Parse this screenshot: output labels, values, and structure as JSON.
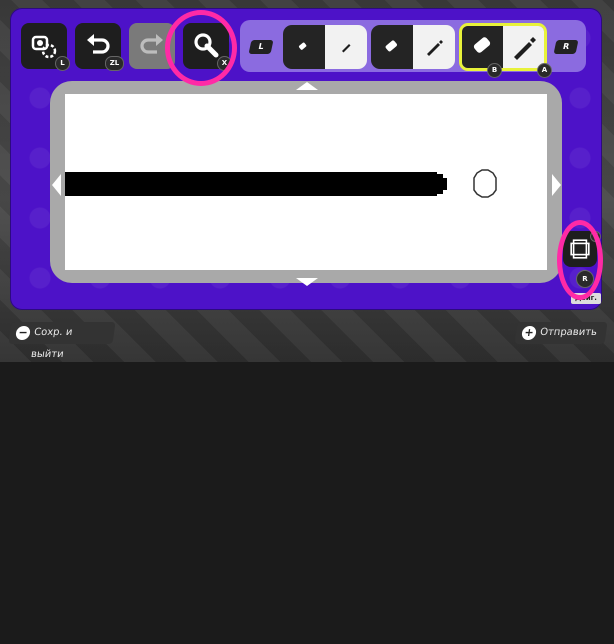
{
  "toolbar": {
    "stamp_badge": "L",
    "undo_badge": "ZL",
    "zoom_badge": "X",
    "left_shoulder": "L",
    "right_shoulder": "R",
    "selected_eraser_badge": "B",
    "selected_pencil_badge": "A"
  },
  "side": {
    "frame_badge": "Y",
    "frame_button_badge": "R",
    "move_label": "Двиг."
  },
  "bottom": {
    "save_exit_symbol": "−",
    "save_exit_label": "Сохр. и выйти",
    "send_symbol": "+",
    "send_label": "Отправить"
  },
  "colors": {
    "panel": "#4d12c8",
    "highlight": "#ff2aa6",
    "selected_outline": "#e8f23a",
    "canvas": "#ffffff",
    "stroke": "#000000"
  },
  "icons": {
    "stamp": "stamp-icon",
    "undo": "undo-icon",
    "redo": "redo-icon",
    "zoom": "magnifier-icon",
    "eraser": "eraser-icon",
    "pencil": "pencil-icon",
    "frame": "frame-icon"
  }
}
